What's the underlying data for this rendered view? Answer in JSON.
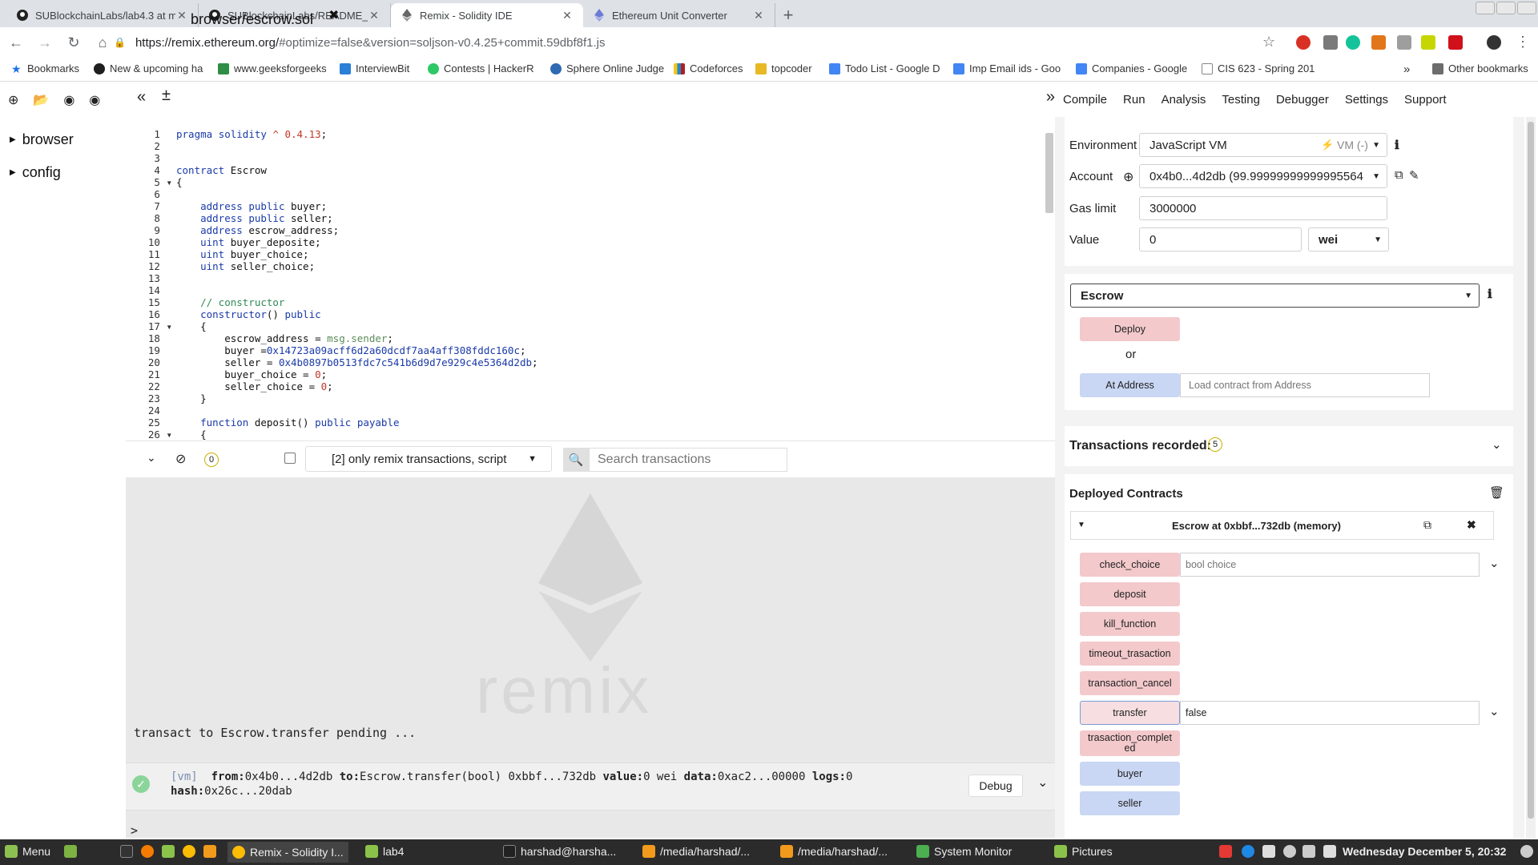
{
  "browser": {
    "tabs": [
      {
        "title": "SUBlockchainLabs/lab4.3 at ma",
        "active": false
      },
      {
        "title": "SUBlockchainLabs/README_so",
        "active": false
      },
      {
        "title": "Remix - Solidity IDE",
        "active": true
      },
      {
        "title": "Ethereum Unit Converter",
        "active": false
      }
    ],
    "url_host": "https://remix.ethereum.org/",
    "url_rest": "#optimize=false&version=soljson-v0.4.25+commit.59dbf8f1.js",
    "bookmarks": [
      "Bookmarks",
      "New & upcoming ha",
      "www.geeksforgeeks",
      "InterviewBit",
      "Contests | HackerR",
      "Sphere Online Judge",
      "Codeforces",
      "topcoder",
      "Todo List - Google D",
      "Imp Email ids - Goo",
      "Companies - Google",
      "CIS 623 - Spring 201",
      "Other bookmarks"
    ],
    "bookmarks_more": "»"
  },
  "filetree": {
    "items": [
      "browser",
      "config"
    ]
  },
  "editor": {
    "tab_label": "browser/escrow.sol",
    "tab_close": "✖",
    "lines": [
      "pragma solidity ^ 0.4.13;",
      "",
      "",
      "contract Escrow",
      "{",
      "",
      "    address public buyer;",
      "    address public seller;",
      "    address escrow_address;",
      "    uint buyer_deposite;",
      "    uint buyer_choice;",
      "    uint seller_choice;",
      "",
      "",
      "    // constructor",
      "    constructor() public",
      "    {",
      "        escrow_address = msg.sender;",
      "        buyer =0x14723a09acff6d2a60dcdf7aa4aff308fddc160c;",
      "        seller = 0x4b0897b0513fdc7c541b6d9d7e929c4e5364d2db;",
      "        buyer_choice = 0;",
      "        seller_choice = 0;",
      "    }",
      "",
      "    function deposit() public payable",
      "    {"
    ]
  },
  "terminal": {
    "pending_count": "0",
    "filter_label": "[2] only remix transactions, script",
    "search_placeholder": "Search transactions",
    "pending_msg": "transact to Escrow.transfer pending ...",
    "log_tag": "[vm]",
    "log_from_key": "from:",
    "log_from": "0x4b0...4d2db",
    "log_to_key": "to:",
    "log_to": "Escrow.transfer(bool) 0xbbf...732db",
    "log_value_key": "value:",
    "log_value": "0 wei",
    "log_data_key": "data:",
    "log_data": "0xac2...00000",
    "log_logs_key": "logs:",
    "log_logs": "0",
    "log_hash_key": "hash:",
    "log_hash": "0x26c...20dab",
    "debug_label": "Debug",
    "prompt": ">",
    "watermark": "remix"
  },
  "right_tabs": [
    "Compile",
    "Run",
    "Analysis",
    "Testing",
    "Debugger",
    "Settings",
    "Support"
  ],
  "run": {
    "env_label": "Environment",
    "env_value": "JavaScript VM",
    "env_vm": "VM (-)",
    "account_label": "Account",
    "account_value": "0x4b0...4d2db (99.99999999999995564",
    "gas_label": "Gas limit",
    "gas_value": "3000000",
    "value_label": "Value",
    "value_value": "0",
    "value_unit": "wei",
    "contract_select": "Escrow",
    "deploy_label": "Deploy",
    "or_label": "or",
    "at_address_label": "At Address",
    "at_address_placeholder": "Load contract from Address",
    "tx_recorded_label": "Transactions recorded:",
    "tx_recorded_count": "5",
    "deployed_title": "Deployed Contracts",
    "instance_title": "Escrow at 0xbbf...732db (memory)",
    "functions": [
      {
        "name": "check_choice",
        "kind": "pink",
        "arg_placeholder": "bool choice",
        "arg_value": ""
      },
      {
        "name": "deposit",
        "kind": "pink"
      },
      {
        "name": "kill_function",
        "kind": "pink"
      },
      {
        "name": "timeout_trasaction",
        "kind": "pink"
      },
      {
        "name": "transaction_cancel",
        "kind": "pink"
      },
      {
        "name": "transfer",
        "kind": "pink",
        "arg_value": "false"
      },
      {
        "name": "trasaction_complet ed",
        "kind": "pink"
      },
      {
        "name": "buyer",
        "kind": "blue"
      },
      {
        "name": "seller",
        "kind": "blue"
      }
    ]
  },
  "taskbar": {
    "menu": "Menu",
    "items": [
      "Remix - Solidity I...",
      "lab4",
      "harshad@harsha...",
      "/media/harshad/...",
      "/media/harshad/...",
      "System Monitor",
      "Pictures"
    ],
    "clock": "Wednesday December  5, 20:32"
  }
}
